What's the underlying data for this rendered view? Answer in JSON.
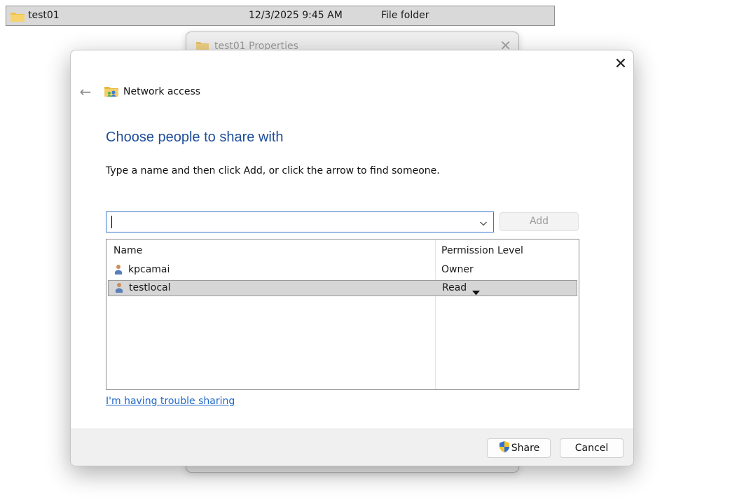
{
  "explorer": {
    "row": {
      "name": "test01",
      "date_modified": "12/3/2025 9:45 AM",
      "type": "File folder"
    }
  },
  "properties_window": {
    "title": "test01 Properties"
  },
  "dialog": {
    "title": "Network access",
    "heading": "Choose people to share with",
    "instruction": "Type a name and then click Add, or click the arrow to find someone.",
    "name_input": {
      "value": ""
    },
    "add_label": "Add",
    "columns": {
      "name": "Name",
      "permission": "Permission Level"
    },
    "people": [
      {
        "name": "kpcamai",
        "permission": "Owner"
      },
      {
        "name": "testlocal",
        "permission": "Read"
      }
    ],
    "trouble_link": "I'm having trouble sharing",
    "share_label": "Share",
    "cancel_label": "Cancel"
  },
  "icons": {
    "folder": "folder-icon",
    "network": "network-access-icon",
    "user": "user-icon",
    "shield": "uac-shield-icon",
    "close": "close-icon",
    "back": "back-arrow-icon",
    "dropdown": "chevron-down-icon"
  },
  "colors": {
    "heading": "#1e4d9a",
    "link": "#1f66c7",
    "input_focus_border": "#3a78c9",
    "selected_row": "#d6d6d6",
    "folder": "#f2c04d"
  }
}
